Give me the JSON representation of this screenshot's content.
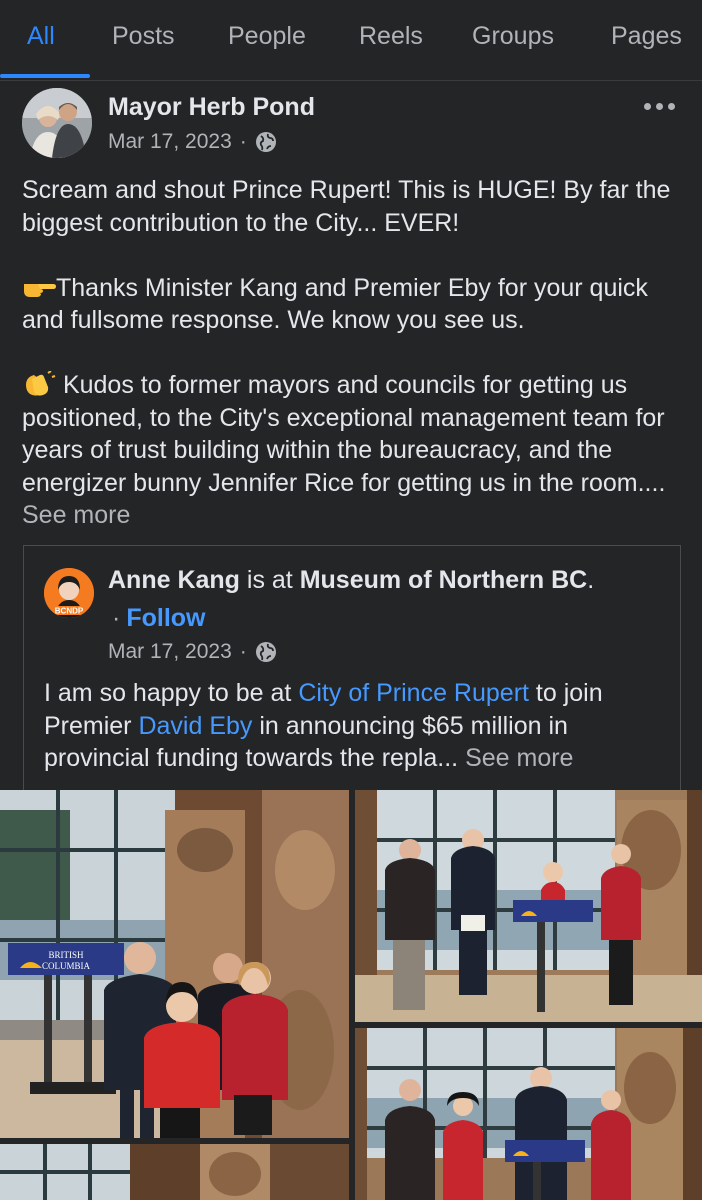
{
  "tabs": [
    {
      "label": "All",
      "active": true
    },
    {
      "label": "Posts"
    },
    {
      "label": "People"
    },
    {
      "label": "Reels"
    },
    {
      "label": "Groups"
    },
    {
      "label": "Pages"
    }
  ],
  "post": {
    "author": "Mayor Herb Pond",
    "date": "Mar 17, 2023",
    "separator": "·",
    "paragraph1": "Scream and shout Prince Rupert!  This is HUGE!  By far the biggest contribution to the City... EVER!",
    "paragraph2": "Thanks Minister Kang and Premier Eby for your quick and fullsome response.  We know you see us.",
    "paragraph3": " Kudos to former mayors and councils for getting us positioned, to the City's exceptional management team for years of trust building within the bureaucracy, and the energizer bunny Jennifer Rice for getting us in the room....",
    "see_more": "See more"
  },
  "shared": {
    "author": "Anne Kang",
    "is_at": " is at ",
    "place": "Museum of Northern BC",
    "place_end": ".",
    "follow": "Follow",
    "dot": "·",
    "date": "Mar 17, 2023",
    "separator": "·",
    "avatar_badge": "BCNDP",
    "text_1": "I am so happy to be at ",
    "link_1": "City of Prince Rupert",
    "text_2": " to join Premier ",
    "link_2": "David Eby",
    "text_3": " in announcing $65 million in provincial funding towards the repla...",
    "see_more": "See more"
  },
  "photos": {
    "podium_sign_line1": "BRITISH",
    "podium_sign_line2": "COLUMBIA"
  },
  "colors": {
    "background": "#242526",
    "accent": "#2d88ff",
    "link": "#4599ff",
    "text": "#e4e6eb",
    "muted": "#b0b3b8"
  }
}
